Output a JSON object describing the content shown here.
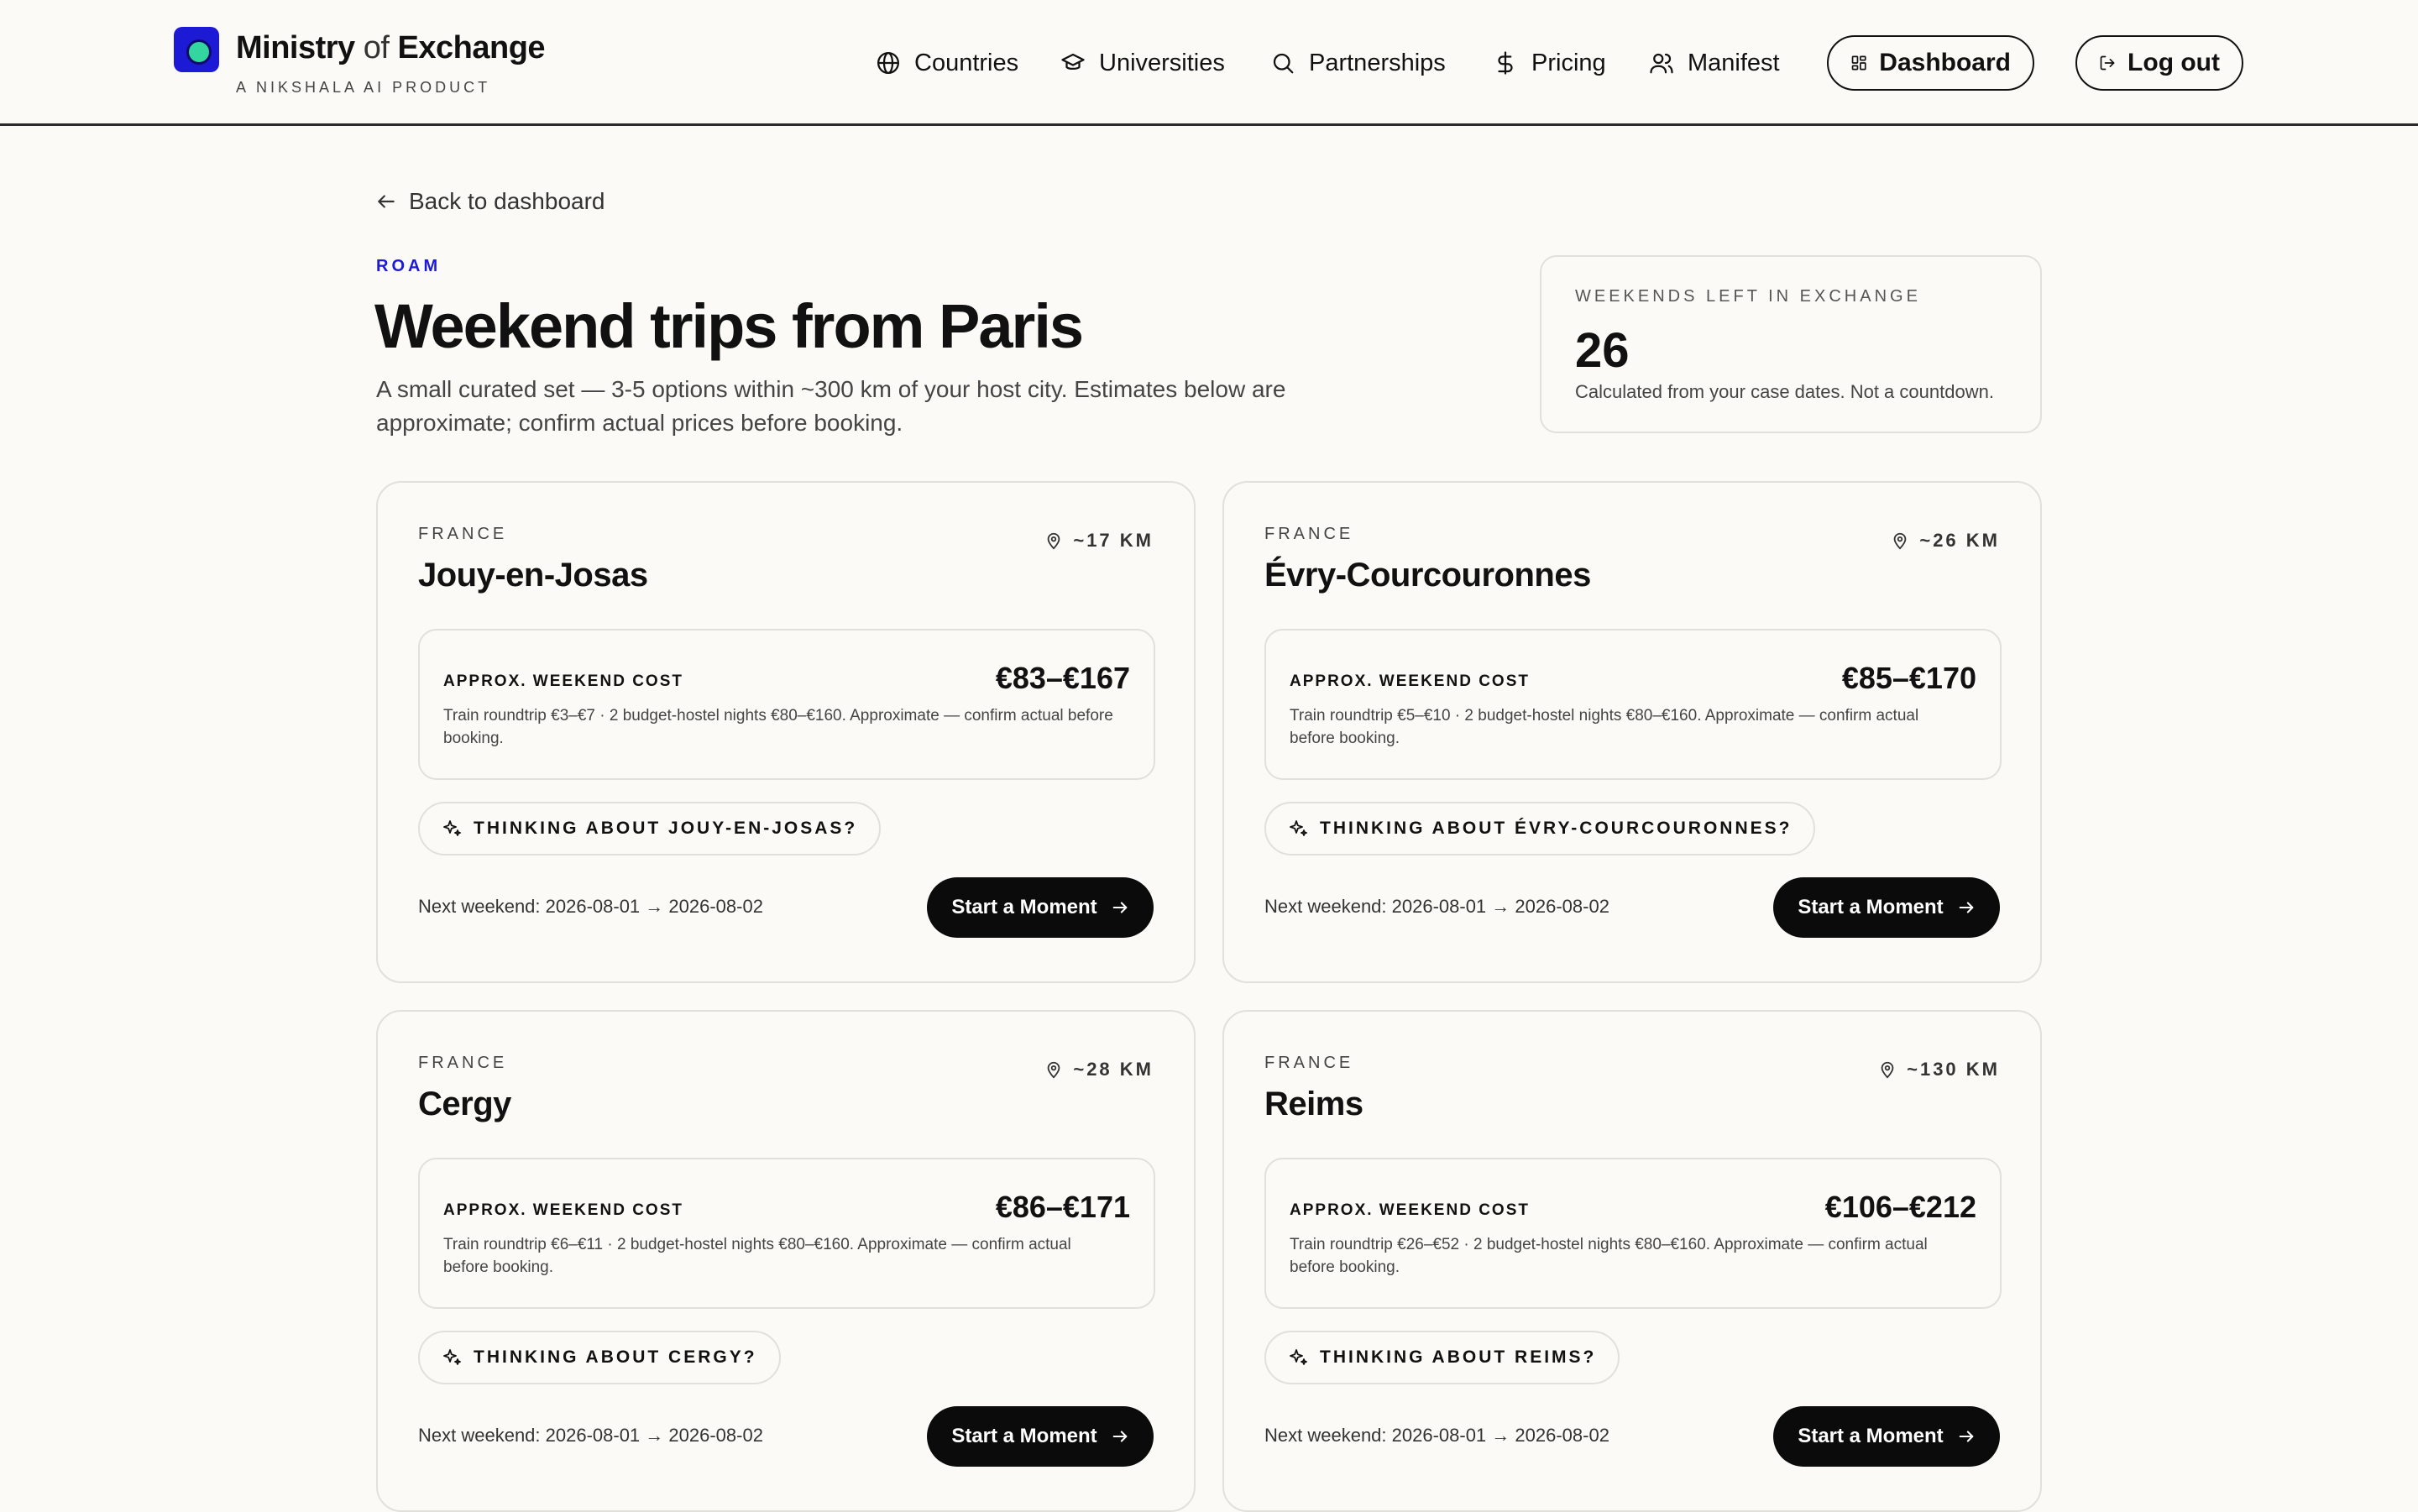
{
  "brand": {
    "title_pre": "Ministry",
    "title_of": "of",
    "title_post": "Exchange",
    "subtitle": "A NIKSHALA AI PRODUCT",
    "logo_color": "#1d1ad6"
  },
  "nav": {
    "items": [
      {
        "label": "Countries",
        "icon": "globe-icon"
      },
      {
        "label": "Universities",
        "icon": "graduation-cap-icon"
      },
      {
        "label": "Partnerships",
        "icon": "search-icon"
      },
      {
        "label": "Pricing",
        "icon": "dollar-icon"
      },
      {
        "label": "Manifest",
        "icon": "users-icon"
      }
    ],
    "dashboard_label": "Dashboard",
    "logout_label": "Log out"
  },
  "back": {
    "label": "Back to dashboard"
  },
  "section": {
    "eyebrow": "ROAM",
    "title": "Weekend trips from Paris",
    "description": "A small curated set — 3-5 options within ~300 km of your host city. Estimates below are approximate; confirm actual prices before booking.",
    "accent": "#1d1ad6"
  },
  "weekends": {
    "label": "WEEKENDS LEFT IN EXCHANGE",
    "value": "26",
    "note": "Calculated from your case dates. Not a countdown."
  },
  "trips": [
    {
      "country": "FRANCE",
      "distance": "~17 KM",
      "name": "Jouy-en-Josas",
      "cost_label": "APPROX. WEEKEND COST",
      "cost_value": "€83–€167",
      "cost_note": "Train roundtrip €3–€7 · 2 budget-hostel nights €80–€160. Approximate — confirm actual before booking.",
      "thinking_label": "THINKING ABOUT JOUY-EN-JOSAS?",
      "next_weekend": "Next weekend: 2026-08-01 → 2026-08-02",
      "cta": "Start a Moment"
    },
    {
      "country": "FRANCE",
      "distance": "~26 KM",
      "name": "Évry-Courcouronnes",
      "cost_label": "APPROX. WEEKEND COST",
      "cost_value": "€85–€170",
      "cost_note": "Train roundtrip €5–€10 · 2 budget-hostel nights €80–€160. Approximate — confirm actual before booking.",
      "thinking_label": "THINKING ABOUT ÉVRY-COURCOURONNES?",
      "next_weekend": "Next weekend: 2026-08-01 → 2026-08-02",
      "cta": "Start a Moment"
    },
    {
      "country": "FRANCE",
      "distance": "~28 KM",
      "name": "Cergy",
      "cost_label": "APPROX. WEEKEND COST",
      "cost_value": "€86–€171",
      "cost_note": "Train roundtrip €6–€11 · 2 budget-hostel nights €80–€160. Approximate — confirm actual before booking.",
      "thinking_label": "THINKING ABOUT CERGY?",
      "next_weekend": "Next weekend: 2026-08-01 → 2026-08-02",
      "cta": "Start a Moment"
    },
    {
      "country": "FRANCE",
      "distance": "~130 KM",
      "name": "Reims",
      "cost_label": "APPROX. WEEKEND COST",
      "cost_value": "€106–€212",
      "cost_note": "Train roundtrip €26–€52 · 2 budget-hostel nights €80–€160. Approximate — confirm actual before booking.",
      "thinking_label": "THINKING ABOUT REIMS?",
      "next_weekend": "Next weekend: 2026-08-01 → 2026-08-02",
      "cta": "Start a Moment"
    }
  ]
}
